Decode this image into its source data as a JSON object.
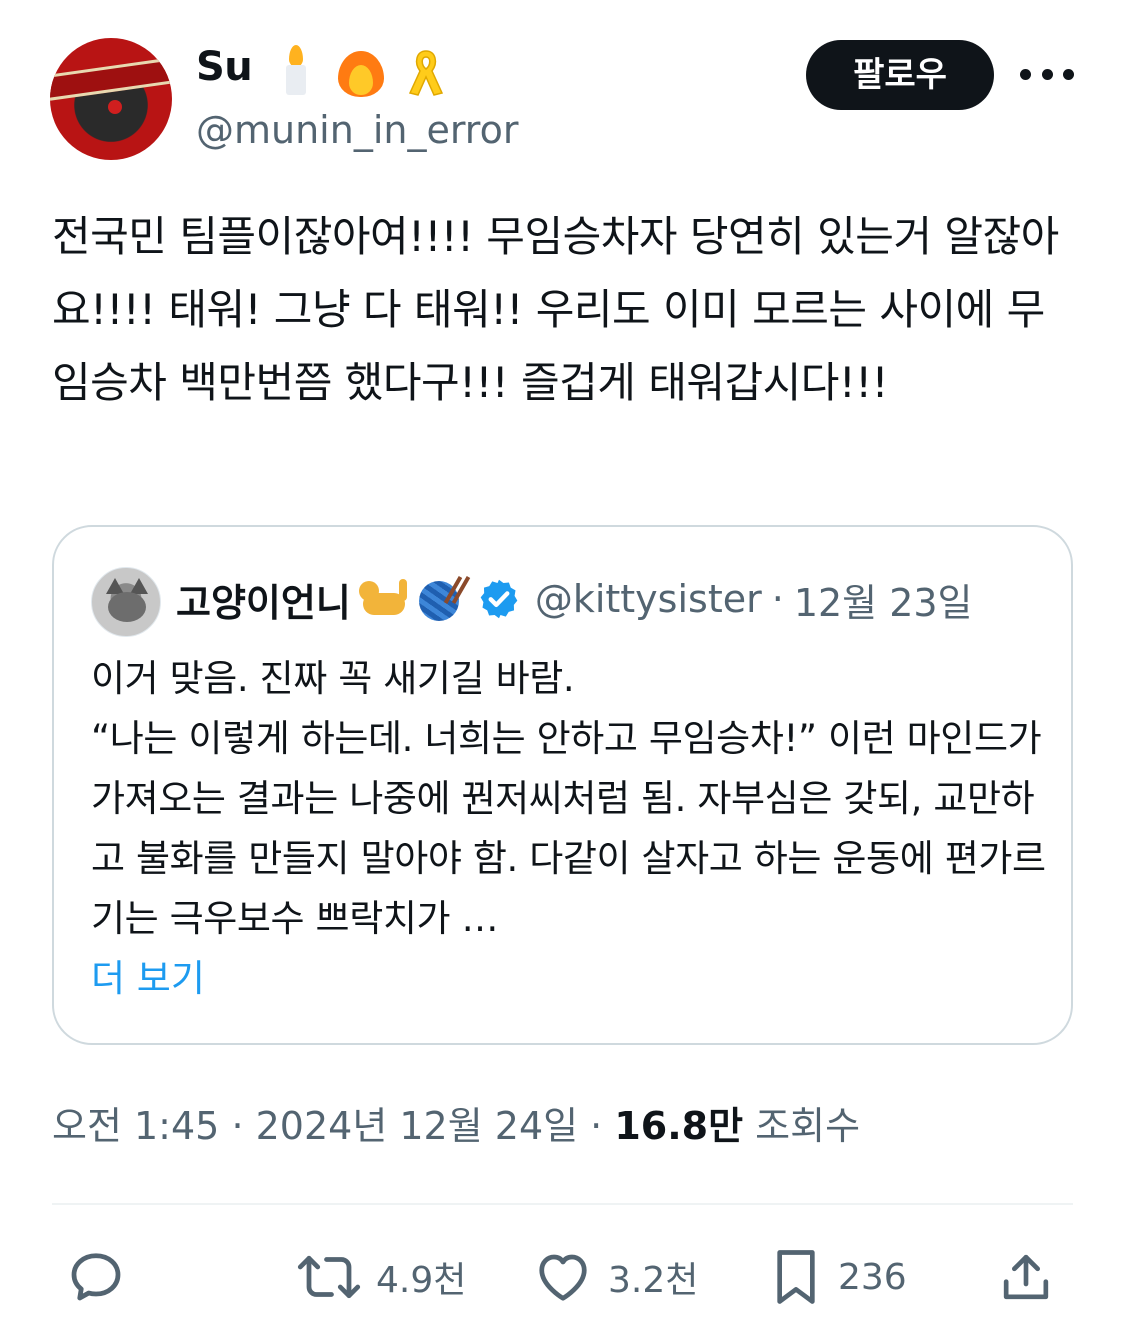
{
  "tweet": {
    "user_name": "Su",
    "user_emojis": [
      "candle-emoji",
      "fire-emoji",
      "yellow-ribbon-emoji"
    ],
    "user_handle": "@munin_in_error",
    "follow_label": "팔로우",
    "text": "전국민 팀플이잖아여!!!! 무임승차자 당연히 있는거 알잖아요!!!! 태워! 그냥 다 태워!! 우리도 이미 모르는 사이에 무임승차 백만번쯤 했다구!!! 즐겁게 태워갑시다!!!",
    "time": "오전 1:45",
    "separator": "·",
    "date": "2024년 12월 24일",
    "views_count": "16.8만",
    "views_label": "조회수"
  },
  "quote": {
    "user_name": "고양이언니",
    "user_emojis": [
      "cat-emoji",
      "yarn-emoji"
    ],
    "verified": true,
    "user_handle": "@kittysister",
    "separator": "·",
    "date": "12월 23일",
    "text": "이거 맞음. 진짜 꼭 새기길 바람.\n“나는 이렇게 하는데. 너희는 안하고 무임승차!” 이런 마인드가 가져오는 결과는 나중에 꿘저씨처럼 됨. 자부심은 갖되, 교만하고 불화를 만들지 말아야 함. 다같이 살자고 하는 운동에 편가르기는 극우보수 쁘락치가 …",
    "show_more": "더 보기"
  },
  "actions": {
    "reply_icon": "speech-bubble-icon",
    "retweet_count": "4.9천",
    "like_count": "3.2천",
    "bookmark_count": "236",
    "share_icon": "share-upload-icon"
  },
  "colors": {
    "text_primary": "#0f1419",
    "text_secondary": "#536471",
    "link_blue": "#1d9bf0",
    "border": "#cfd9de",
    "divider": "#eff3f4",
    "follow_button_bg": "#0f1419"
  }
}
